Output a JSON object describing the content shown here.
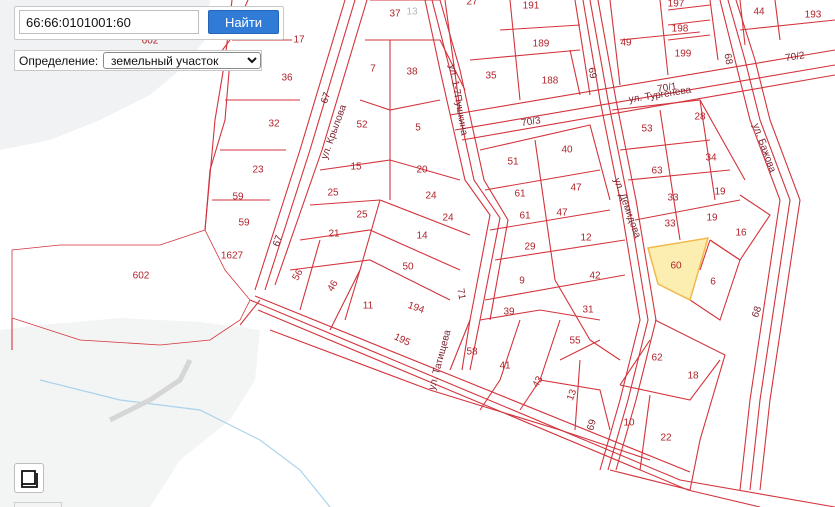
{
  "search": {
    "value": "66:66:0101001:60",
    "button_label": "Найти"
  },
  "definition": {
    "label": "Определение:",
    "selected": "земельный участок"
  },
  "highlight_color": "#fbeeb0",
  "parcel_color": "#d3343c",
  "parcels": [
    {
      "t": "37"
    },
    {
      "t": "13"
    },
    {
      "t": "27"
    },
    {
      "t": "191"
    },
    {
      "t": "197"
    },
    {
      "t": "198"
    },
    {
      "t": "199"
    },
    {
      "t": "44"
    },
    {
      "t": "193"
    },
    {
      "t": "602"
    },
    {
      "t": "17"
    },
    {
      "t": "189"
    },
    {
      "t": "49"
    },
    {
      "t": "35"
    },
    {
      "t": "188"
    },
    {
      "t": "7"
    },
    {
      "t": "38"
    },
    {
      "t": "36"
    },
    {
      "t": "52"
    },
    {
      "t": "5"
    },
    {
      "t": "53"
    },
    {
      "t": "28"
    },
    {
      "t": "32"
    },
    {
      "t": "51"
    },
    {
      "t": "40"
    },
    {
      "t": "34"
    },
    {
      "t": "15"
    },
    {
      "t": "20"
    },
    {
      "t": "63"
    },
    {
      "t": "23"
    },
    {
      "t": "61"
    },
    {
      "t": "47"
    },
    {
      "t": "25"
    },
    {
      "t": "24"
    },
    {
      "t": "33"
    },
    {
      "t": "19"
    },
    {
      "t": "59"
    },
    {
      "t": "25"
    },
    {
      "t": "24"
    },
    {
      "t": "61"
    },
    {
      "t": "47"
    },
    {
      "t": "33"
    },
    {
      "t": "19"
    },
    {
      "t": "59"
    },
    {
      "t": "16"
    },
    {
      "t": "21"
    },
    {
      "t": "14"
    },
    {
      "t": "12"
    },
    {
      "t": "29"
    },
    {
      "t": "1627"
    },
    {
      "t": "60"
    },
    {
      "t": "50"
    },
    {
      "t": "56"
    },
    {
      "t": "6"
    },
    {
      "t": "602"
    },
    {
      "t": "9"
    },
    {
      "t": "42"
    },
    {
      "t": "46"
    },
    {
      "t": "39"
    },
    {
      "t": "31"
    },
    {
      "t": "11"
    },
    {
      "t": "194"
    },
    {
      "t": "195"
    },
    {
      "t": "55"
    },
    {
      "t": "58"
    },
    {
      "t": "62"
    },
    {
      "t": "41"
    },
    {
      "t": "18"
    },
    {
      "t": "43"
    },
    {
      "t": "13"
    },
    {
      "t": "10"
    },
    {
      "t": "22"
    }
  ],
  "streets": [
    {
      "t": "70/3"
    },
    {
      "t": "70/1"
    },
    {
      "t": "70/2"
    },
    {
      "t": "ул. Тургенева"
    },
    {
      "t": "ул. Крылова"
    },
    {
      "t": "ул. 1-7Пушкина"
    },
    {
      "t": "ул. Демидова"
    },
    {
      "t": "ул. Бажова"
    },
    {
      "t": "ул. Татищева"
    },
    {
      "t": "67"
    },
    {
      "t": "67"
    },
    {
      "t": "69"
    },
    {
      "t": "68"
    },
    {
      "t": "68"
    },
    {
      "t": "71"
    },
    {
      "t": "69"
    }
  ]
}
